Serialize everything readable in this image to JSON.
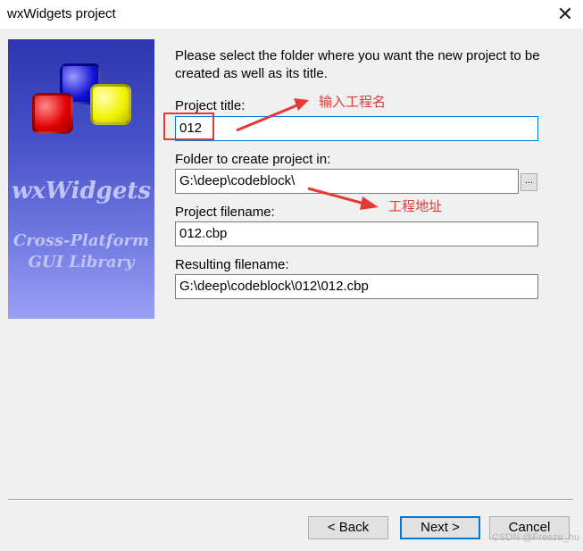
{
  "window": {
    "title": "wxWidgets project",
    "close_glyph": "✕"
  },
  "banner": {
    "logo_main": "wxWidgets",
    "logo_sub1": "Cross-Platform",
    "logo_sub2": "GUI Library"
  },
  "form": {
    "instructions": "Please select the folder where you want the new project to be created as well as its title.",
    "project_title_label": "Project title:",
    "project_title_value": "012",
    "folder_label": "Folder to create project in:",
    "folder_value": "G:\\deep\\codeblock\\",
    "browse_label": "...",
    "filename_label": "Project filename:",
    "filename_value": "012.cbp",
    "resulting_label": "Resulting filename:",
    "resulting_value": "G:\\deep\\codeblock\\012\\012.cbp"
  },
  "annotations": {
    "title_note": "输入工程名",
    "folder_note": "工程地址",
    "color": "#e53935"
  },
  "buttons": {
    "back": "< Back",
    "next": "Next >",
    "cancel": "Cancel"
  },
  "watermark": "CSDN @Freeze_hu"
}
